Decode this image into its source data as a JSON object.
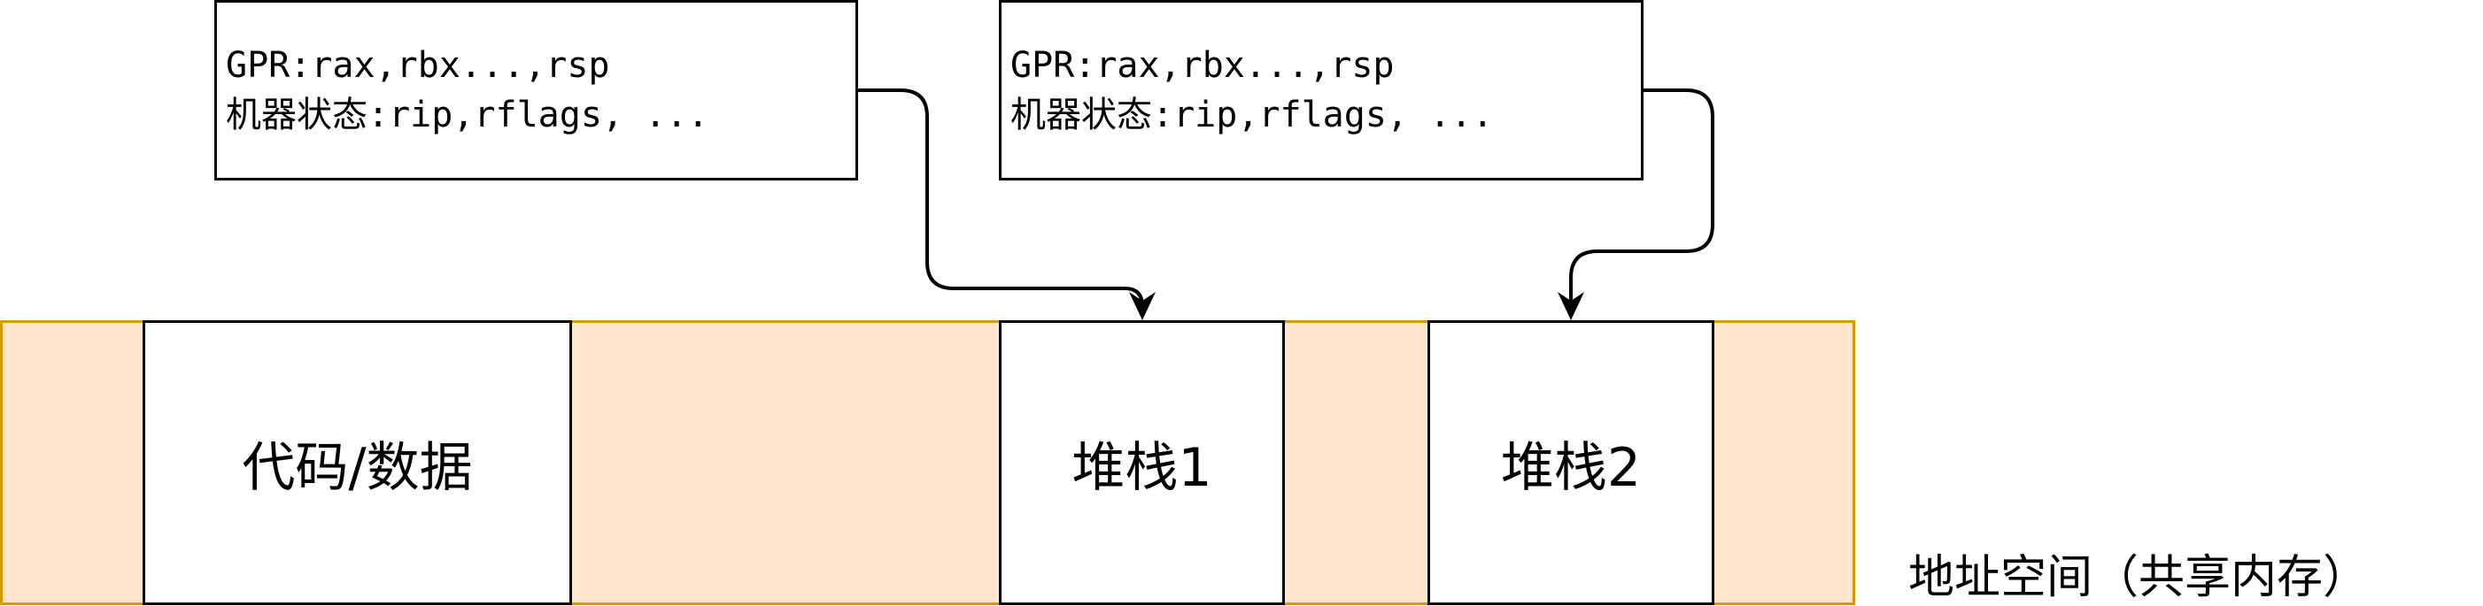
{
  "threads": [
    {
      "line1": "GPR:rax,rbx...,rsp",
      "line2": "机器状态:rip,rflags, ..."
    },
    {
      "line1": "GPR:rax,rbx...,rsp",
      "line2": "机器状态:rip,rflags, ..."
    }
  ],
  "memory": {
    "code_data": "代码/数据",
    "stack1": "堆栈1",
    "stack2": "堆栈2",
    "caption": "地址空间（共享内存）"
  },
  "colors": {
    "memory_fill": "#ffe6cc",
    "memory_border": "#d79b00",
    "box_border": "#000000"
  }
}
